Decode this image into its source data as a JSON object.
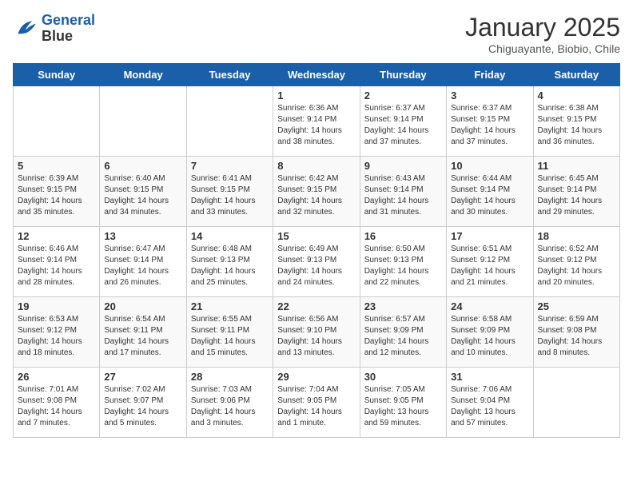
{
  "header": {
    "logo_line1": "General",
    "logo_line2": "Blue",
    "month": "January 2025",
    "location": "Chiguayante, Biobio, Chile"
  },
  "days_of_week": [
    "Sunday",
    "Monday",
    "Tuesday",
    "Wednesday",
    "Thursday",
    "Friday",
    "Saturday"
  ],
  "weeks": [
    [
      {
        "day": "",
        "info": ""
      },
      {
        "day": "",
        "info": ""
      },
      {
        "day": "",
        "info": ""
      },
      {
        "day": "1",
        "info": "Sunrise: 6:36 AM\nSunset: 9:14 PM\nDaylight: 14 hours\nand 38 minutes."
      },
      {
        "day": "2",
        "info": "Sunrise: 6:37 AM\nSunset: 9:14 PM\nDaylight: 14 hours\nand 37 minutes."
      },
      {
        "day": "3",
        "info": "Sunrise: 6:37 AM\nSunset: 9:15 PM\nDaylight: 14 hours\nand 37 minutes."
      },
      {
        "day": "4",
        "info": "Sunrise: 6:38 AM\nSunset: 9:15 PM\nDaylight: 14 hours\nand 36 minutes."
      }
    ],
    [
      {
        "day": "5",
        "info": "Sunrise: 6:39 AM\nSunset: 9:15 PM\nDaylight: 14 hours\nand 35 minutes."
      },
      {
        "day": "6",
        "info": "Sunrise: 6:40 AM\nSunset: 9:15 PM\nDaylight: 14 hours\nand 34 minutes."
      },
      {
        "day": "7",
        "info": "Sunrise: 6:41 AM\nSunset: 9:15 PM\nDaylight: 14 hours\nand 33 minutes."
      },
      {
        "day": "8",
        "info": "Sunrise: 6:42 AM\nSunset: 9:15 PM\nDaylight: 14 hours\nand 32 minutes."
      },
      {
        "day": "9",
        "info": "Sunrise: 6:43 AM\nSunset: 9:14 PM\nDaylight: 14 hours\nand 31 minutes."
      },
      {
        "day": "10",
        "info": "Sunrise: 6:44 AM\nSunset: 9:14 PM\nDaylight: 14 hours\nand 30 minutes."
      },
      {
        "day": "11",
        "info": "Sunrise: 6:45 AM\nSunset: 9:14 PM\nDaylight: 14 hours\nand 29 minutes."
      }
    ],
    [
      {
        "day": "12",
        "info": "Sunrise: 6:46 AM\nSunset: 9:14 PM\nDaylight: 14 hours\nand 28 minutes."
      },
      {
        "day": "13",
        "info": "Sunrise: 6:47 AM\nSunset: 9:14 PM\nDaylight: 14 hours\nand 26 minutes."
      },
      {
        "day": "14",
        "info": "Sunrise: 6:48 AM\nSunset: 9:13 PM\nDaylight: 14 hours\nand 25 minutes."
      },
      {
        "day": "15",
        "info": "Sunrise: 6:49 AM\nSunset: 9:13 PM\nDaylight: 14 hours\nand 24 minutes."
      },
      {
        "day": "16",
        "info": "Sunrise: 6:50 AM\nSunset: 9:13 PM\nDaylight: 14 hours\nand 22 minutes."
      },
      {
        "day": "17",
        "info": "Sunrise: 6:51 AM\nSunset: 9:12 PM\nDaylight: 14 hours\nand 21 minutes."
      },
      {
        "day": "18",
        "info": "Sunrise: 6:52 AM\nSunset: 9:12 PM\nDaylight: 14 hours\nand 20 minutes."
      }
    ],
    [
      {
        "day": "19",
        "info": "Sunrise: 6:53 AM\nSunset: 9:12 PM\nDaylight: 14 hours\nand 18 minutes."
      },
      {
        "day": "20",
        "info": "Sunrise: 6:54 AM\nSunset: 9:11 PM\nDaylight: 14 hours\nand 17 minutes."
      },
      {
        "day": "21",
        "info": "Sunrise: 6:55 AM\nSunset: 9:11 PM\nDaylight: 14 hours\nand 15 minutes."
      },
      {
        "day": "22",
        "info": "Sunrise: 6:56 AM\nSunset: 9:10 PM\nDaylight: 14 hours\nand 13 minutes."
      },
      {
        "day": "23",
        "info": "Sunrise: 6:57 AM\nSunset: 9:09 PM\nDaylight: 14 hours\nand 12 minutes."
      },
      {
        "day": "24",
        "info": "Sunrise: 6:58 AM\nSunset: 9:09 PM\nDaylight: 14 hours\nand 10 minutes."
      },
      {
        "day": "25",
        "info": "Sunrise: 6:59 AM\nSunset: 9:08 PM\nDaylight: 14 hours\nand 8 minutes."
      }
    ],
    [
      {
        "day": "26",
        "info": "Sunrise: 7:01 AM\nSunset: 9:08 PM\nDaylight: 14 hours\nand 7 minutes."
      },
      {
        "day": "27",
        "info": "Sunrise: 7:02 AM\nSunset: 9:07 PM\nDaylight: 14 hours\nand 5 minutes."
      },
      {
        "day": "28",
        "info": "Sunrise: 7:03 AM\nSunset: 9:06 PM\nDaylight: 14 hours\nand 3 minutes."
      },
      {
        "day": "29",
        "info": "Sunrise: 7:04 AM\nSunset: 9:05 PM\nDaylight: 14 hours\nand 1 minute."
      },
      {
        "day": "30",
        "info": "Sunrise: 7:05 AM\nSunset: 9:05 PM\nDaylight: 13 hours\nand 59 minutes."
      },
      {
        "day": "31",
        "info": "Sunrise: 7:06 AM\nSunset: 9:04 PM\nDaylight: 13 hours\nand 57 minutes."
      },
      {
        "day": "",
        "info": ""
      }
    ]
  ]
}
